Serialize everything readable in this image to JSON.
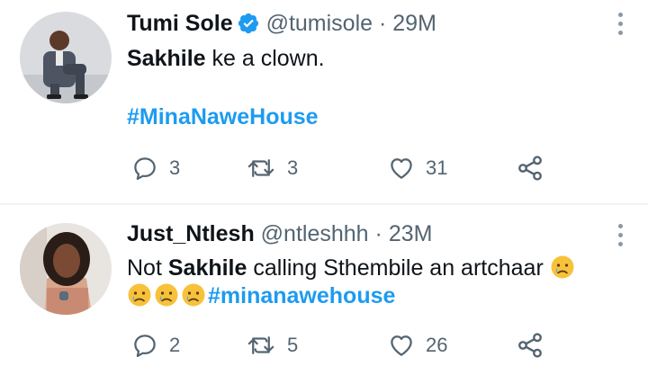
{
  "tweets": [
    {
      "name": "Tumi Sole",
      "verified": true,
      "handle": "@tumisole",
      "separator": "·",
      "time": "29M",
      "text_bold": "Sakhile",
      "text_rest": " ke a clown.",
      "hashtag": "#MinaNaweHouse",
      "counts": {
        "replies": "3",
        "retweets": "3",
        "likes": "31"
      }
    },
    {
      "name": "Just_Ntlesh",
      "verified": false,
      "handle": "@ntleshhh",
      "separator": "·",
      "time": "23M",
      "text_pre": "Not ",
      "text_bold": "Sakhile",
      "text_rest": " calling Sthembile an artchaar",
      "emoji": "crying-face",
      "hashtag": "#minanawehouse",
      "counts": {
        "replies": "2",
        "retweets": "5",
        "likes": "26"
      }
    }
  ],
  "icons": {
    "reply": "reply-icon",
    "retweet": "retweet-icon",
    "like": "heart-icon",
    "share": "share-icon",
    "more": "more-icon",
    "verified": "verified-badge-icon"
  },
  "colors": {
    "hashtag": "#1d9bf0",
    "secondary_text": "#536471",
    "verified_badge": "#1d9bf0",
    "emoji_face": "#f7c23a"
  }
}
